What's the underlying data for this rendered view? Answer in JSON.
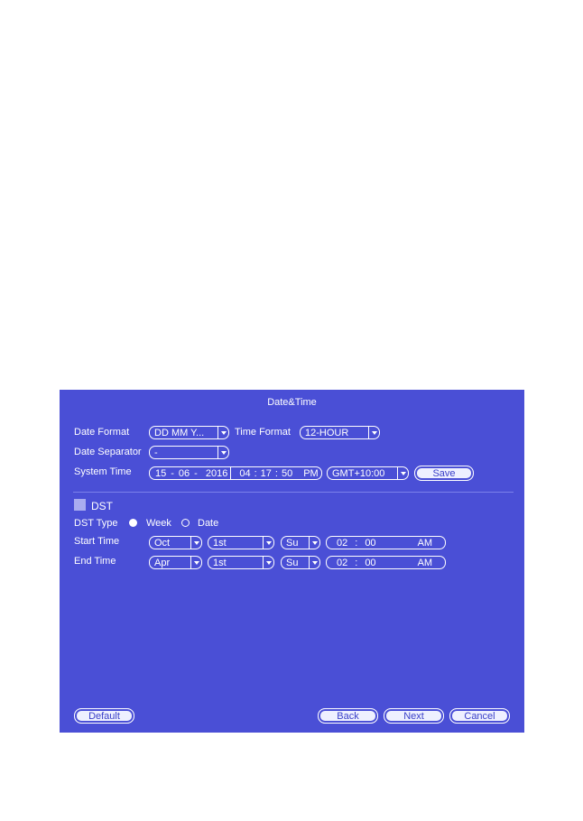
{
  "window": {
    "title": "Date&Time"
  },
  "general": {
    "date_format_label": "Date Format",
    "date_format_value": "DD MM Y...",
    "time_format_label": "Time Format",
    "time_format_value": "12-HOUR",
    "date_separator_label": "Date Separator",
    "date_separator_value": "-",
    "system_time_label": "System Time",
    "system_date": {
      "day": "15",
      "month": "06",
      "year": "2016",
      "sep": "-"
    },
    "system_clock": {
      "hour": "04",
      "minute": "17",
      "second": "50",
      "ampm": "PM",
      "sep": ":"
    },
    "timezone_value": "GMT+10:00",
    "save_label": "Save"
  },
  "dst": {
    "label": "DST",
    "checked": false,
    "type_label": "DST Type",
    "type_options": [
      {
        "label": "Week",
        "selected": true
      },
      {
        "label": "Date",
        "selected": false
      }
    ],
    "start": {
      "label": "Start Time",
      "month": "Oct",
      "week": "1st",
      "day": "Su",
      "hour": "02",
      "minute": "00",
      "ampm": "AM"
    },
    "end": {
      "label": "End Time",
      "month": "Apr",
      "week": "1st",
      "day": "Su",
      "hour": "02",
      "minute": "00",
      "ampm": "AM"
    }
  },
  "footer": {
    "default_label": "Default",
    "back_label": "Back",
    "next_label": "Next",
    "cancel_label": "Cancel"
  },
  "colors": {
    "panel": "#4a4fd6",
    "text": "#ffffff",
    "button_text": "#3a40c8"
  },
  "icons": {
    "dropdown": "chevron-down-icon",
    "checkbox": "checkbox-icon",
    "radio": "radio-icon"
  }
}
